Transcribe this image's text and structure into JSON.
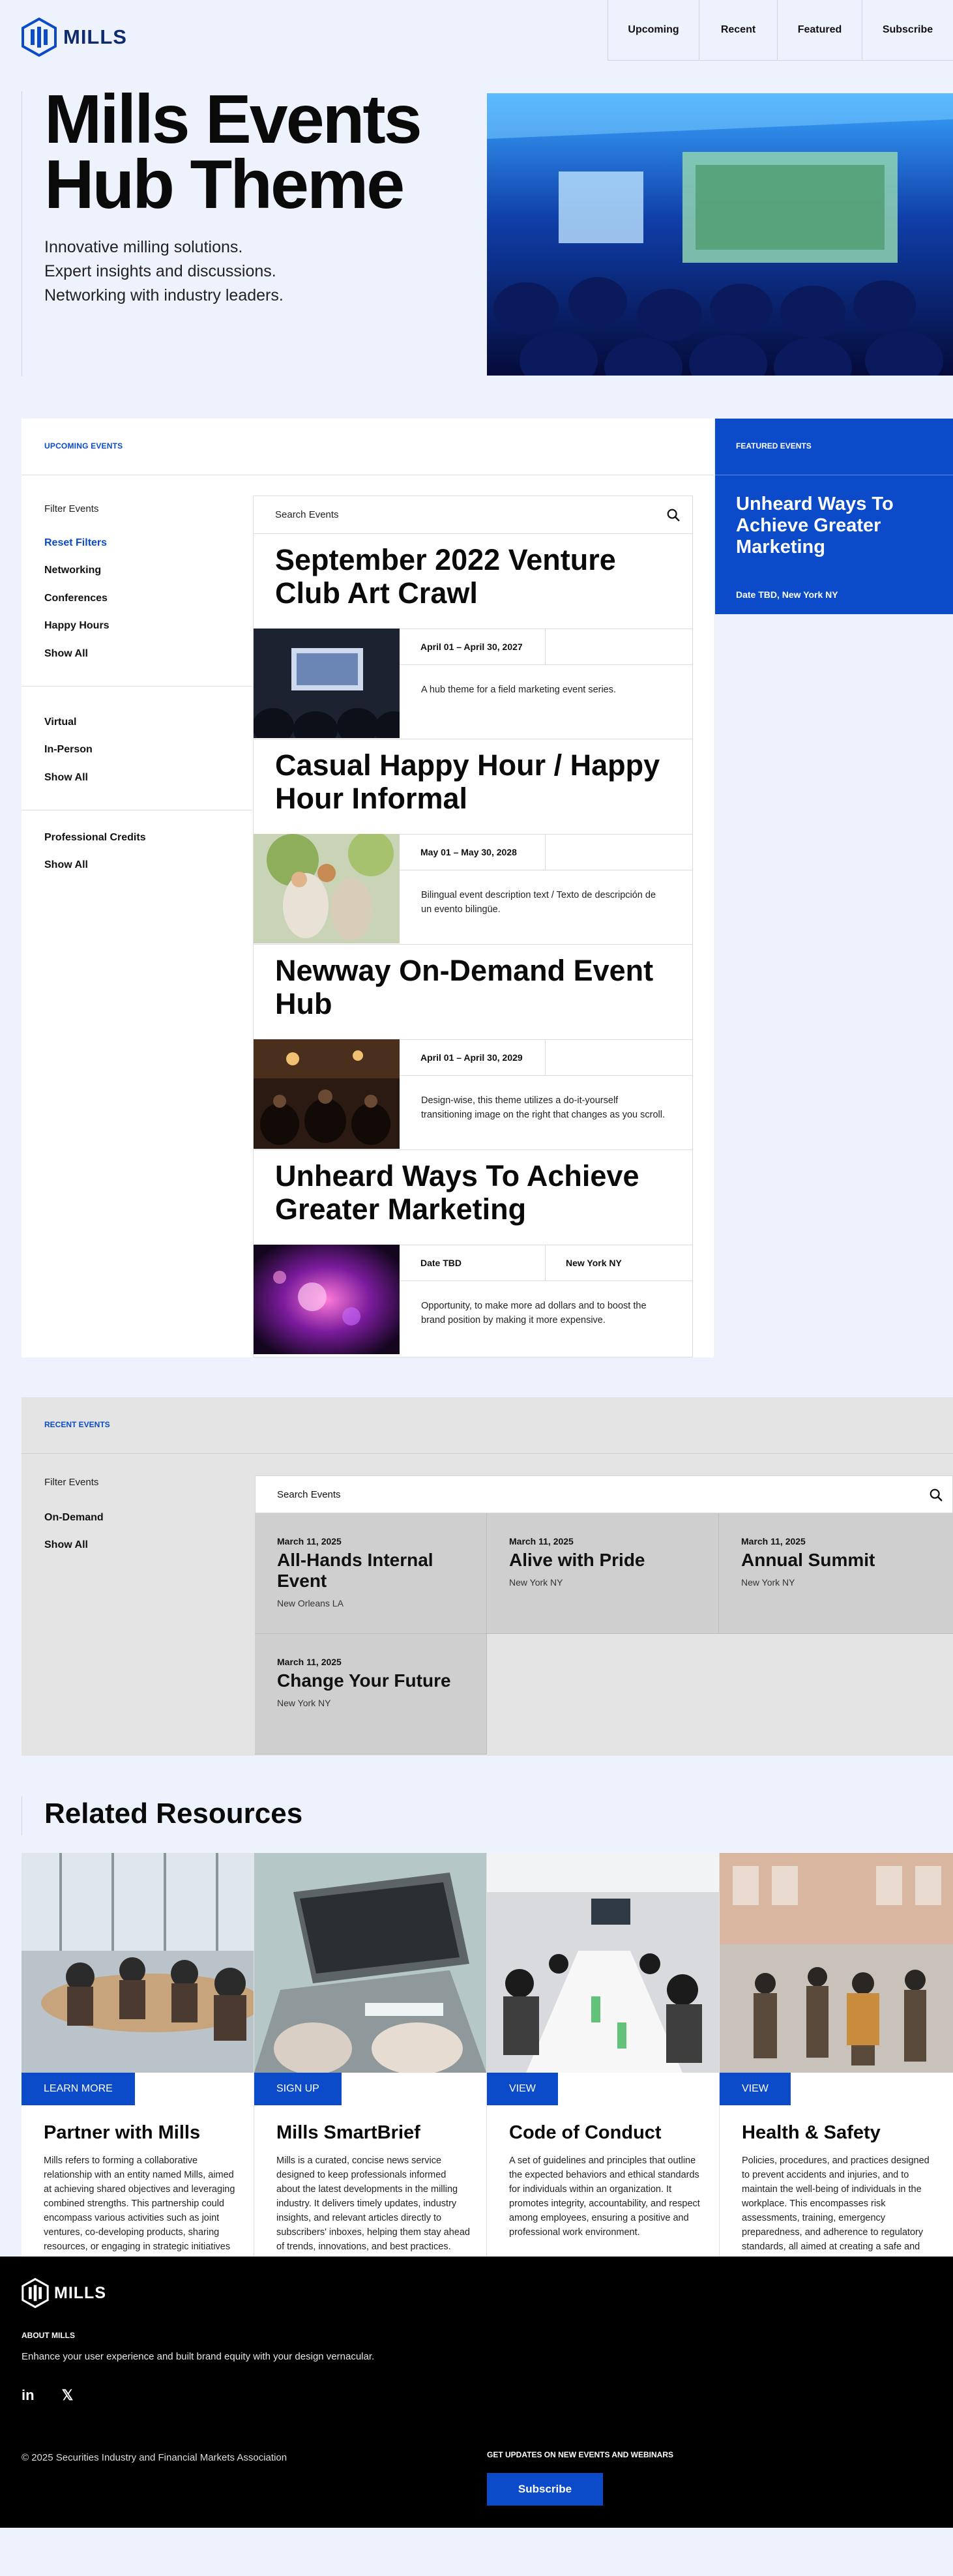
{
  "header": {
    "logo_text": "MILLS",
    "nav": [
      {
        "label": "Upcoming"
      },
      {
        "label": "Recent"
      },
      {
        "label": "Featured"
      },
      {
        "label": "Subscribe"
      }
    ]
  },
  "hero": {
    "title_line1": "Mills Events",
    "title_line2": "Hub Theme",
    "lines": [
      "Innovative milling solutions.",
      "Expert insights and discussions.",
      "Networking with industry leaders."
    ]
  },
  "upcoming": {
    "label": "UPCOMING EVENTS",
    "filter_heading": "Filter Events",
    "filters_group1": [
      "Reset Filters",
      "Networking",
      "Conferences",
      "Happy Hours",
      "Show All"
    ],
    "filters_group2": [
      "Virtual",
      "In-Person",
      "Show All"
    ],
    "filters_group3": [
      "Professional Credits",
      "Show All"
    ],
    "search_placeholder": "Search Events",
    "events": [
      {
        "title": "September 2022 Venture Club Art Crawl",
        "date": "April 01 – April 30, 2027",
        "location": "",
        "description": "A hub theme for a field marketing event series."
      },
      {
        "title": "Casual Happy Hour / Happy Hour Informal",
        "date": "May 01 – May 30, 2028",
        "location": "",
        "description": "Bilingual event description text / Texto de descripción de un evento bilingüe."
      },
      {
        "title": "Newway On-Demand Event Hub",
        "date": "April 01 – April 30, 2029",
        "location": "",
        "description": "Design-wise, this theme utilizes a do-it-yourself transitioning image on the right that changes as you scroll."
      },
      {
        "title": "Unheard Ways To Achieve Greater Marketing",
        "date": "Date TBD",
        "location": "New York NY",
        "description": "Opportunity, to make more ad dollars and to boost the brand position by making it more expensive."
      }
    ]
  },
  "featured": {
    "label": "FEATURED EVENTS",
    "title": "Unheard Ways To Achieve Greater Marketing",
    "meta": "Date TBD, New York NY"
  },
  "recent": {
    "label": "RECENT EVENTS",
    "filter_heading": "Filter Events",
    "filters": [
      "On-Demand",
      "Show All"
    ],
    "search_placeholder": "Search Events",
    "cards": [
      {
        "date": "March 11, 2025",
        "name": "All-Hands Internal Event",
        "location": "New Orleans LA"
      },
      {
        "date": "March 11, 2025",
        "name": "Alive with Pride",
        "location": "New York NY"
      },
      {
        "date": "March 11, 2025",
        "name": "Annual Summit",
        "location": "New York NY"
      },
      {
        "date": "March 11, 2025",
        "name": "Change Your Future",
        "location": "New York NY"
      }
    ]
  },
  "resources": {
    "title": "Related Resources",
    "cards": [
      {
        "button": "LEARN MORE",
        "title": "Partner with Mills",
        "text": "Mills refers to forming a collaborative relationship with an entity named Mills, aimed at achieving shared objectives and leveraging combined strengths. This partnership could encompass various activities such as joint ventures, co-developing products, sharing resources, or engaging in strategic initiatives to drive mutual growth and success."
      },
      {
        "button": "SIGN UP",
        "title": "Mills SmartBrief",
        "text": "Mills is a curated, concise news service designed to keep professionals informed about the latest developments in the milling industry. It delivers timely updates, industry insights, and relevant articles directly to subscribers' inboxes, helping them stay ahead of trends, innovations, and best practices."
      },
      {
        "button": "VIEW",
        "title": "Code of Conduct",
        "text": "A set of guidelines and principles that outline the expected behaviors and ethical standards for individuals within an organization. It promotes integrity, accountability, and respect among employees, ensuring a positive and professional work environment."
      },
      {
        "button": "VIEW",
        "title": "Health & Safety",
        "text": "Policies, procedures, and practices designed to prevent accidents and injuries, and to maintain the well-being of individuals in the workplace. This encompasses risk assessments, training, emergency preparedness, and adherence to regulatory standards, all aimed at creating a safe and healthy work environment."
      }
    ]
  },
  "footer": {
    "logo_text": "MILLS",
    "about_label": "ABOUT MILLS",
    "tagline": "Enhance your user experience and built brand equity with your design vernacular.",
    "social": [
      "in",
      "𝕏"
    ],
    "copyright": "© 2025 Securities Industry and Financial Markets Association",
    "updates_label": "GET UPDATES ON NEW EVENTS AND WEBINARS",
    "subscribe": "Subscribe"
  },
  "colors": {
    "accent": "#0b4bc9",
    "page_bg": "#eef2fd",
    "recent_bg": "#e4e4e4",
    "card_bg": "#cfcfcf"
  }
}
